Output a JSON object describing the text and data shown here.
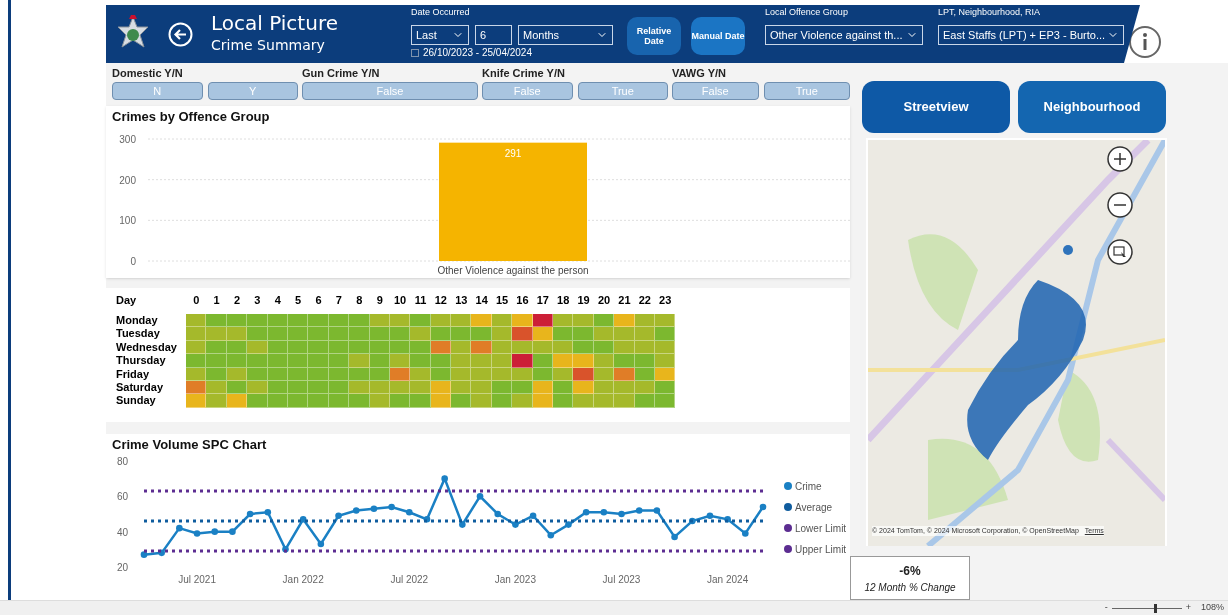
{
  "header": {
    "title": "Local Picture",
    "subtitle": "Crime Summary",
    "date_filter": {
      "label": "Date Occurred",
      "mode": "Last",
      "count": "6",
      "unit": "Months",
      "range": "26/10/2023 - 25/04/2024"
    },
    "date_buttons": [
      "Relative Date",
      "Manual Date"
    ],
    "offence_group": {
      "label": "Local Offence Group",
      "value": "Other Violence against th..."
    },
    "area": {
      "label": "LPT, Neighbourhood, RIA",
      "value": "East Staffs (LPT) + EP3 - Burto..."
    }
  },
  "slicers": [
    {
      "label": "Domestic Y/N",
      "options": [
        {
          "text": "N",
          "selected": false
        },
        {
          "text": "Y",
          "selected": false
        }
      ]
    },
    {
      "label": "Gun Crime Y/N",
      "options": [
        {
          "text": "False",
          "selected": false
        }
      ]
    },
    {
      "label": "Knife Crime Y/N",
      "options": [
        {
          "text": "False",
          "selected": false
        },
        {
          "text": "True",
          "selected": false
        }
      ]
    },
    {
      "label": "VAWG Y/N",
      "options": [
        {
          "text": "False",
          "selected": false
        },
        {
          "text": "True",
          "selected": false
        }
      ]
    }
  ],
  "offence_chart": {
    "title": "Crimes by Offence Group",
    "chart_data": {
      "type": "bar",
      "categories": [
        "Other Violence against the person"
      ],
      "series": [
        {
          "color": "#f5b400",
          "values": [
            291
          ]
        }
      ],
      "ylim": [
        0,
        300
      ],
      "yticks": [
        0,
        100,
        200,
        300
      ],
      "data_labels": true
    }
  },
  "heatmap": {
    "corner": "Day",
    "hours": [
      "0",
      "1",
      "2",
      "3",
      "4",
      "5",
      "6",
      "7",
      "8",
      "9",
      "10",
      "11",
      "12",
      "13",
      "14",
      "15",
      "16",
      "17",
      "18",
      "19",
      "20",
      "21",
      "22",
      "23"
    ],
    "rows": [
      {
        "day": "Monday",
        "cells": [
          {
            "color": "#a5b92b"
          },
          {
            "color": "#7cb82f"
          },
          {
            "color": "#7cb82f"
          },
          {
            "color": "#7cb82f"
          },
          {
            "color": "#7cb82f"
          },
          {
            "color": "#7cb82f"
          },
          {
            "color": "#7cb82f"
          },
          {
            "color": "#7cb82f"
          },
          {
            "color": "#7cb82f"
          },
          {
            "color": "#a5b92b"
          },
          {
            "color": "#a5b92b"
          },
          {
            "color": "#7cb82f"
          },
          {
            "color": "#a5b92b"
          },
          {
            "color": "#a5b92b"
          },
          {
            "color": "#e8b51c"
          },
          {
            "color": "#a5b92b"
          },
          {
            "color": "#e8b51c"
          },
          {
            "color": "#cc1f37"
          },
          {
            "color": "#a5b92b"
          },
          {
            "color": "#a5b92b"
          },
          {
            "color": "#7cb82f"
          },
          {
            "color": "#e8b51c"
          },
          {
            "color": "#a5b92b"
          },
          {
            "color": "#a5b92b"
          }
        ]
      },
      {
        "day": "Tuesday",
        "cells": [
          {
            "color": "#a5b92b"
          },
          {
            "color": "#a5b92b"
          },
          {
            "color": "#a5b92b"
          },
          {
            "color": "#7cb82f"
          },
          {
            "color": "#7cb82f"
          },
          {
            "color": "#7cb82f"
          },
          {
            "color": "#7cb82f"
          },
          {
            "color": "#7cb82f"
          },
          {
            "color": "#7cb82f"
          },
          {
            "color": "#7cb82f"
          },
          {
            "color": "#7cb82f"
          },
          {
            "color": "#a5b92b"
          },
          {
            "color": "#7cb82f"
          },
          {
            "color": "#7cb82f"
          },
          {
            "color": "#7cb82f"
          },
          {
            "color": "#a5b92b"
          },
          {
            "color": "#d9532b"
          },
          {
            "color": "#e8b51c"
          },
          {
            "color": "#7cb82f"
          },
          {
            "color": "#7cb82f"
          },
          {
            "color": "#a5b92b"
          },
          {
            "color": "#a5b92b"
          },
          {
            "color": "#a5b92b"
          },
          {
            "color": "#7cb82f"
          }
        ]
      },
      {
        "day": "Wednesday",
        "cells": [
          {
            "color": "#a5b92b"
          },
          {
            "color": "#7cb82f"
          },
          {
            "color": "#7cb82f"
          },
          {
            "color": "#a5b92b"
          },
          {
            "color": "#7cb82f"
          },
          {
            "color": "#7cb82f"
          },
          {
            "color": "#7cb82f"
          },
          {
            "color": "#7cb82f"
          },
          {
            "color": "#7cb82f"
          },
          {
            "color": "#7cb82f"
          },
          {
            "color": "#7cb82f"
          },
          {
            "color": "#7cb82f"
          },
          {
            "color": "#e07d27"
          },
          {
            "color": "#a5b92b"
          },
          {
            "color": "#e07d27"
          },
          {
            "color": "#a5b92b"
          },
          {
            "color": "#a5b92b"
          },
          {
            "color": "#a5b92b"
          },
          {
            "color": "#a5b92b"
          },
          {
            "color": "#7cb82f"
          },
          {
            "color": "#7cb82f"
          },
          {
            "color": "#a5b92b"
          },
          {
            "color": "#a5b92b"
          },
          {
            "color": "#a5b92b"
          }
        ]
      },
      {
        "day": "Thursday",
        "cells": [
          {
            "color": "#7cb82f"
          },
          {
            "color": "#7cb82f"
          },
          {
            "color": "#7cb82f"
          },
          {
            "color": "#7cb82f"
          },
          {
            "color": "#7cb82f"
          },
          {
            "color": "#7cb82f"
          },
          {
            "color": "#7cb82f"
          },
          {
            "color": "#7cb82f"
          },
          {
            "color": "#a5b92b"
          },
          {
            "color": "#7cb82f"
          },
          {
            "color": "#a5b92b"
          },
          {
            "color": "#7cb82f"
          },
          {
            "color": "#7cb82f"
          },
          {
            "color": "#a5b92b"
          },
          {
            "color": "#a5b92b"
          },
          {
            "color": "#a5b92b"
          },
          {
            "color": "#cc1f37"
          },
          {
            "color": "#7cb82f"
          },
          {
            "color": "#e8b51c"
          },
          {
            "color": "#e8b51c"
          },
          {
            "color": "#a5b92b"
          },
          {
            "color": "#7cb82f"
          },
          {
            "color": "#7cb82f"
          },
          {
            "color": "#a5b92b"
          }
        ]
      },
      {
        "day": "Friday",
        "cells": [
          {
            "color": "#a5b92b"
          },
          {
            "color": "#7cb82f"
          },
          {
            "color": "#a5b92b"
          },
          {
            "color": "#7cb82f"
          },
          {
            "color": "#7cb82f"
          },
          {
            "color": "#7cb82f"
          },
          {
            "color": "#7cb82f"
          },
          {
            "color": "#7cb82f"
          },
          {
            "color": "#7cb82f"
          },
          {
            "color": "#7cb82f"
          },
          {
            "color": "#e07d27"
          },
          {
            "color": "#a5b92b"
          },
          {
            "color": "#7cb82f"
          },
          {
            "color": "#a5b92b"
          },
          {
            "color": "#a5b92b"
          },
          {
            "color": "#a5b92b"
          },
          {
            "color": "#a5b92b"
          },
          {
            "color": "#7cb82f"
          },
          {
            "color": "#a5b92b"
          },
          {
            "color": "#d9532b"
          },
          {
            "color": "#a5b92b"
          },
          {
            "color": "#e07d27"
          },
          {
            "color": "#7cb82f"
          },
          {
            "color": "#e8b51c"
          }
        ]
      },
      {
        "day": "Saturday",
        "cells": [
          {
            "color": "#e07d27"
          },
          {
            "color": "#a5b92b"
          },
          {
            "color": "#7cb82f"
          },
          {
            "color": "#a5b92b"
          },
          {
            "color": "#7cb82f"
          },
          {
            "color": "#7cb82f"
          },
          {
            "color": "#7cb82f"
          },
          {
            "color": "#7cb82f"
          },
          {
            "color": "#a5b92b"
          },
          {
            "color": "#a5b92b"
          },
          {
            "color": "#a5b92b"
          },
          {
            "color": "#a5b92b"
          },
          {
            "color": "#e8b51c"
          },
          {
            "color": "#a5b92b"
          },
          {
            "color": "#a5b92b"
          },
          {
            "color": "#7cb82f"
          },
          {
            "color": "#7cb82f"
          },
          {
            "color": "#e8b51c"
          },
          {
            "color": "#7cb82f"
          },
          {
            "color": "#e8b51c"
          },
          {
            "color": "#a5b92b"
          },
          {
            "color": "#a5b92b"
          },
          {
            "color": "#a5b92b"
          },
          {
            "color": "#7cb82f"
          }
        ]
      },
      {
        "day": "Sunday",
        "cells": [
          {
            "color": "#e8b51c"
          },
          {
            "color": "#a5b92b"
          },
          {
            "color": "#e8b51c"
          },
          {
            "color": "#7cb82f"
          },
          {
            "color": "#7cb82f"
          },
          {
            "color": "#7cb82f"
          },
          {
            "color": "#7cb82f"
          },
          {
            "color": "#7cb82f"
          },
          {
            "color": "#7cb82f"
          },
          {
            "color": "#a5b92b"
          },
          {
            "color": "#7cb82f"
          },
          {
            "color": "#7cb82f"
          },
          {
            "color": "#e8b51c"
          },
          {
            "color": "#7cb82f"
          },
          {
            "color": "#a5b92b"
          },
          {
            "color": "#7cb82f"
          },
          {
            "color": "#a5b92b"
          },
          {
            "color": "#e8b51c"
          },
          {
            "color": "#7cb82f"
          },
          {
            "color": "#a5b92b"
          },
          {
            "color": "#a5b92b"
          },
          {
            "color": "#a5b92b"
          },
          {
            "color": "#7cb82f"
          },
          {
            "color": "#7cb82f"
          }
        ]
      }
    ]
  },
  "spc_chart": {
    "title": "Crime Volume SPC Chart",
    "chart_data": {
      "type": "line",
      "categories": [
        null,
        null,
        null,
        "Jul 2021",
        null,
        null,
        null,
        null,
        null,
        "Jan 2022",
        null,
        null,
        null,
        null,
        null,
        "Jul 2022",
        null,
        null,
        null,
        null,
        null,
        "Jan 2023",
        null,
        null,
        null,
        null,
        null,
        "Jul 2023",
        null,
        null,
        null,
        null,
        null,
        "Jan 2024",
        null,
        null
      ],
      "ylim": [
        20,
        80
      ],
      "yticks": [
        20,
        40,
        60,
        80
      ],
      "legend": "right",
      "series": [
        {
          "name": "Crime",
          "color": "#1a80c4",
          "marker": "circle",
          "values": [
            27,
            28,
            42,
            39,
            40,
            40,
            50,
            51,
            30,
            47,
            33,
            49,
            52,
            53,
            54,
            51,
            47,
            70,
            44,
            60,
            50,
            44,
            49,
            38,
            44,
            51,
            51,
            50,
            52,
            52,
            37,
            46,
            49,
            47,
            39,
            54
          ]
        },
        {
          "name": "Average",
          "color": "#0f5c9e",
          "line_style": "dotted",
          "values": [
            46,
            46,
            46,
            46,
            46,
            46,
            46,
            46,
            46,
            46,
            46,
            46,
            46,
            46,
            46,
            46,
            46,
            46,
            46,
            46,
            46,
            46,
            46,
            46,
            46,
            46,
            46,
            46,
            46,
            46,
            46,
            46,
            46,
            46,
            46,
            46
          ]
        },
        {
          "name": "Lower Limit",
          "color": "#5c2d91",
          "line_style": "dotted",
          "values": [
            29,
            29,
            29,
            29,
            29,
            29,
            29,
            29,
            29,
            29,
            29,
            29,
            29,
            29,
            29,
            29,
            29,
            29,
            29,
            29,
            29,
            29,
            29,
            29,
            29,
            29,
            29,
            29,
            29,
            29,
            29,
            29,
            29,
            29,
            29,
            29
          ]
        },
        {
          "name": "Upper Limit",
          "color": "#5c2d91",
          "line_style": "dotted",
          "values": [
            63,
            63,
            63,
            63,
            63,
            63,
            63,
            63,
            63,
            63,
            63,
            63,
            63,
            63,
            63,
            63,
            63,
            63,
            63,
            63,
            63,
            63,
            63,
            63,
            63,
            63,
            63,
            63,
            63,
            63,
            63,
            63,
            63,
            63,
            63,
            63
          ]
        }
      ]
    }
  },
  "map_buttons": [
    "Streetview",
    "Neighbourhood"
  ],
  "map": {
    "attribution": "© 2024 TomTom, © 2024 Microsoft Corporation, © OpenStreetMap",
    "terms": "Terms"
  },
  "kpi": {
    "value": "-6%",
    "caption": "12 Month % Change"
  },
  "status_bar": {
    "zoom_out": "-",
    "zoom_in": "+",
    "zoom": "108%",
    "level": 0.6
  }
}
